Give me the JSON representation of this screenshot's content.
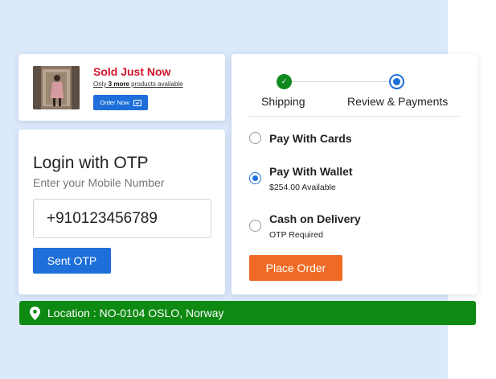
{
  "sold": {
    "title": "Sold Just Now",
    "sub_prefix": "Only ",
    "sub_count": "3 more",
    "sub_suffix": " products available",
    "order_label": "Order Now"
  },
  "login": {
    "title": "Login with OTP",
    "subtitle": "Enter your Mobile Number",
    "phone_value": "+910123456789",
    "sent_label": "Sent OTP"
  },
  "payment": {
    "steps": [
      {
        "label": "Shipping",
        "status": "done"
      },
      {
        "label": "Review & Payments",
        "status": "current"
      }
    ],
    "options": [
      {
        "label": "Pay With Cards",
        "sub": "",
        "selected": false
      },
      {
        "label": "Pay With Wallet",
        "sub": "$254.00 Available",
        "selected": true
      },
      {
        "label": "Cash on Delivery",
        "sub": "OTP Required",
        "selected": false
      }
    ],
    "place_label": "Place Order"
  },
  "location": {
    "text": "Location : NO-0104 OSLO, Norway"
  },
  "colors": {
    "accent_blue": "#1e6fd9",
    "sold_red": "#d0162c",
    "success_green": "#0f8a1e",
    "location_green": "#0e8a13",
    "place_orange": "#ef6a24",
    "background_panel": "#dce9fb"
  },
  "icons": {
    "step_done": "check-icon",
    "order_button": "cart-icon",
    "location": "map-pin-icon"
  }
}
